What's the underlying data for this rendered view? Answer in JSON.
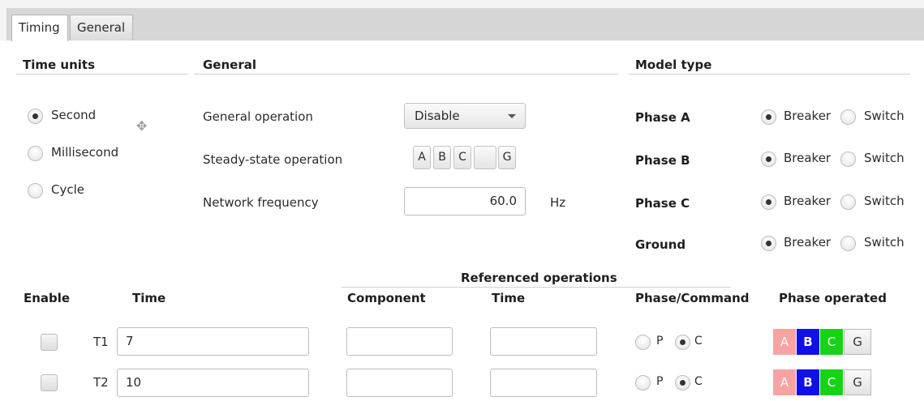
{
  "tabs": [
    {
      "label": "Timing",
      "active": true
    },
    {
      "label": "General",
      "active": false
    }
  ],
  "time_units": {
    "header": "Time units",
    "options": [
      {
        "label": "Second",
        "selected": true
      },
      {
        "label": "Millisecond",
        "selected": false
      },
      {
        "label": "Cycle",
        "selected": false
      }
    ]
  },
  "general": {
    "header": "General",
    "general_operation_label": "General operation",
    "general_operation_value": "Disable",
    "steady_state_label": "Steady-state operation",
    "steady_state_buttons": [
      "A",
      "B",
      "C",
      "G"
    ],
    "network_frequency_label": "Network frequency",
    "network_frequency_value": "60.0",
    "network_frequency_unit": "Hz"
  },
  "model_type": {
    "header": "Model type",
    "breaker_label": "Breaker",
    "switch_label": "Switch",
    "rows": [
      {
        "label": "Phase A",
        "selected": "Breaker"
      },
      {
        "label": "Phase B",
        "selected": "Breaker"
      },
      {
        "label": "Phase C",
        "selected": "Breaker"
      },
      {
        "label": "Ground",
        "selected": "Breaker"
      }
    ]
  },
  "table": {
    "referenced_header": "Referenced operations",
    "columns": {
      "enable": "Enable",
      "time": "Time",
      "component": "Component",
      "ref_time": "Time",
      "phase_command": "Phase/Command",
      "phase_operated": "Phase operated"
    },
    "p_label": "P",
    "c_label": "C",
    "phase_buttons": [
      {
        "label": "A",
        "bg": "#f7a3a3",
        "fg": "#ffffff"
      },
      {
        "label": "B",
        "bg": "#1010e8",
        "fg": "#ffffff"
      },
      {
        "label": "C",
        "bg": "#18d218",
        "fg": "#ffffff"
      },
      {
        "label": "G",
        "bg": "#ececec",
        "fg": "#333333"
      }
    ],
    "rows": [
      {
        "id": "T1",
        "time": "7",
        "component": "",
        "ref_time": "",
        "selected": "C",
        "enabled": false
      },
      {
        "id": "T2",
        "time": "10",
        "component": "",
        "ref_time": "",
        "selected": "C",
        "enabled": false
      }
    ]
  }
}
